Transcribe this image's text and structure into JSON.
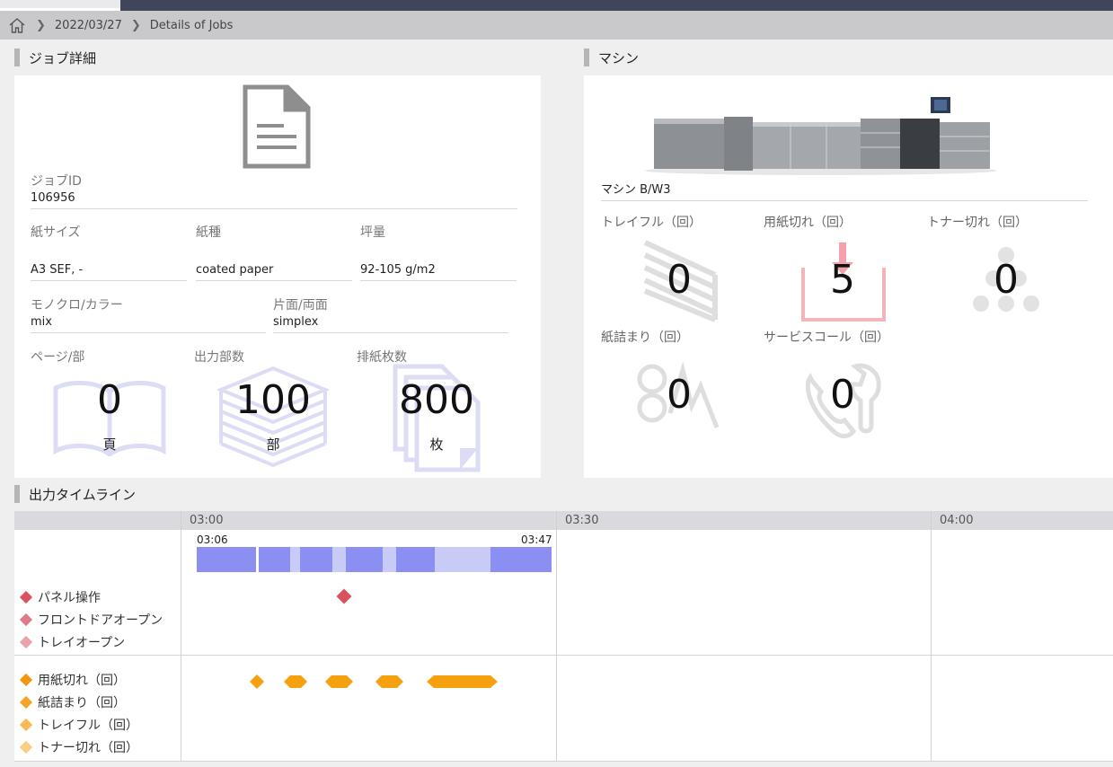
{
  "breadcrumb": {
    "date": "2022/03/27",
    "page": "Details of Jobs"
  },
  "job_section": {
    "title": "ジョブ詳細",
    "job_id_label": "ジョブID",
    "job_id": "106956",
    "paper_size_label": "紙サイズ",
    "paper_size": "A3 SEF, -",
    "paper_type_label": "紙種",
    "paper_type": "coated paper",
    "weight_label": "坪量",
    "weight": "92-105 g/m2",
    "color_label": "モノクロ/カラー",
    "color": "mix",
    "duplex_label": "片面/両面",
    "duplex": "simplex",
    "pages_label": "ページ/部",
    "pages": "0",
    "pages_unit": "頁",
    "copies_label": "出力部数",
    "copies": "100",
    "copies_unit": "部",
    "sheets_label": "排紙枚数",
    "sheets": "800",
    "sheets_unit": "枚"
  },
  "machine_section": {
    "title": "マシン",
    "machine_name": "マシン B/W3",
    "tray_full_label": "トレイフル（回）",
    "tray_full": "0",
    "paper_out_label": "用紙切れ（回）",
    "paper_out": "5",
    "toner_out_label": "トナー切れ（回）",
    "toner_out": "0",
    "paper_jam_label": "紙詰まり（回）",
    "paper_jam": "0",
    "service_call_label": "サービスコール（回）",
    "service_call": "0"
  },
  "timeline": {
    "title": "出力タイムライン",
    "ticks": [
      "03:00",
      "03:30",
      "04:00"
    ],
    "start_time": "03:06",
    "end_time": "03:47",
    "legend_top": [
      {
        "label": "パネル操作",
        "color": "#d9535e"
      },
      {
        "label": "フロントドアオープン",
        "color": "#de7b86"
      },
      {
        "label": "トレイオープン",
        "color": "#e8a3ab"
      }
    ],
    "legend_bottom": [
      {
        "label": "用紙切れ（回）",
        "color": "#f5940f"
      },
      {
        "label": "紙詰まり（回）",
        "color": "#f5a427"
      },
      {
        "label": "トレイフル（回）",
        "color": "#f8b854"
      },
      {
        "label": "トナー切れ（回）",
        "color": "#fbcd80"
      }
    ]
  },
  "colors": {
    "job_icon": "#dcdcf5",
    "output_bar": "#8b8ff2",
    "output_bar_light": "#c8cbf6",
    "event_orange": "#f5a10f",
    "panel_op_red": "#d9535e",
    "paper_out_pink": "#f2a2a8"
  }
}
